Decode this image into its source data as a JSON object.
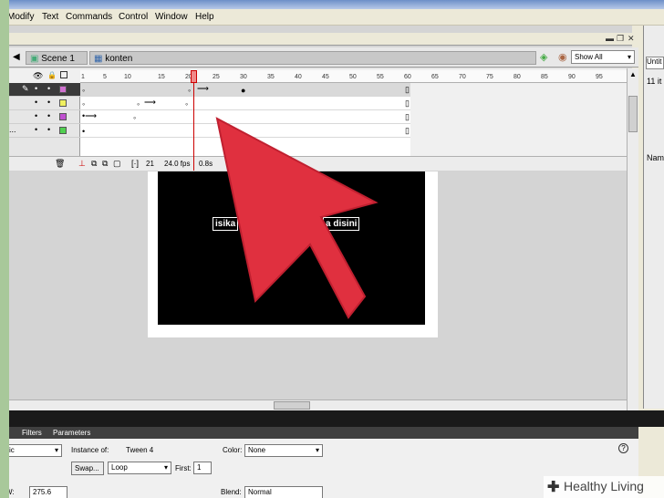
{
  "menubar": {
    "items": [
      "Modify",
      "Text",
      "Commands",
      "Control",
      "Window",
      "Help"
    ]
  },
  "scene": {
    "scene_label": "Scene 1",
    "symbol_label": "konten",
    "view_select": "Show All"
  },
  "right_panel": {
    "doc_select": "Untit",
    "items_count": "11 it",
    "name_header": "Nam"
  },
  "timeline": {
    "ticks": [
      "1",
      "5",
      "10",
      "15",
      "20",
      "25",
      "30",
      "35",
      "40",
      "45",
      "50",
      "55",
      "60",
      "65",
      "70",
      "75",
      "80",
      "85",
      "90",
      "95"
    ],
    "layers": [
      {
        "name": "",
        "color": "#d070d0"
      },
      {
        "name": "",
        "color": "#f0f060"
      },
      {
        "name": "",
        "color": "#c050d0"
      },
      {
        "name": "...",
        "color": "#50d050"
      }
    ],
    "current_frame": "21",
    "fps": "24.0 fps",
    "time": "0.8s"
  },
  "stage": {
    "text_left": "isika",
    "text_right": "a disini"
  },
  "properties": {
    "tabs": [
      "Filters",
      "Parameters"
    ],
    "instance_of_label": "Instance of:",
    "instance_of_value": "Tween 4",
    "behavior_value": "ic",
    "swap_button": "Swap...",
    "loop_value": "Loop",
    "first_label": "First:",
    "first_value": "1",
    "color_label": "Color:",
    "color_value": "None",
    "x_value": "275.6",
    "blend_label": "Blend:",
    "blend_value": "Normal"
  },
  "watermark": {
    "text": "Healthy Living"
  },
  "colors": {
    "arrow": "#e0303f",
    "stage": "#000000",
    "playhead": "#cc0000"
  }
}
